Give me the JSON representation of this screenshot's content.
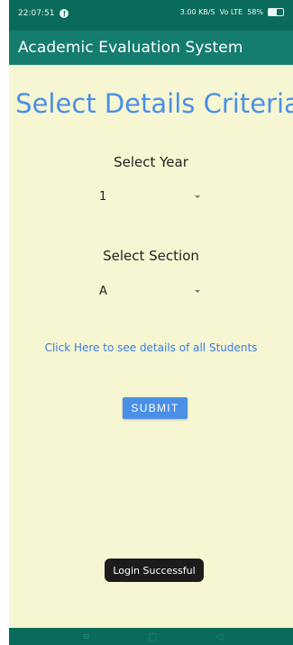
{
  "status_bar": {
    "time": "22:07:51",
    "notification_glyph": "!",
    "network_info": "3.00 KB/S",
    "signal_info": "Vo LTE",
    "battery_percent": "58%",
    "battery_level": 0.58
  },
  "app_bar": {
    "title": "Academic Evaluation System"
  },
  "main": {
    "heading": "Select Details Criteria",
    "year_label": "Select Year",
    "year_value": "1",
    "section_label": "Select Section",
    "section_value": "A",
    "details_link": "Click Here to see details of all Students",
    "submit_label": "SUBMIT"
  },
  "toast": {
    "message": "Login Successful"
  },
  "nav_bar": {
    "menu_glyph": "≡",
    "home_glyph": "□",
    "back_glyph": "◁"
  },
  "colors": {
    "status_bar": "#0b6b5a",
    "app_bar": "#147d6d",
    "background": "#f6f6d2",
    "accent": "#4a8fe6"
  }
}
